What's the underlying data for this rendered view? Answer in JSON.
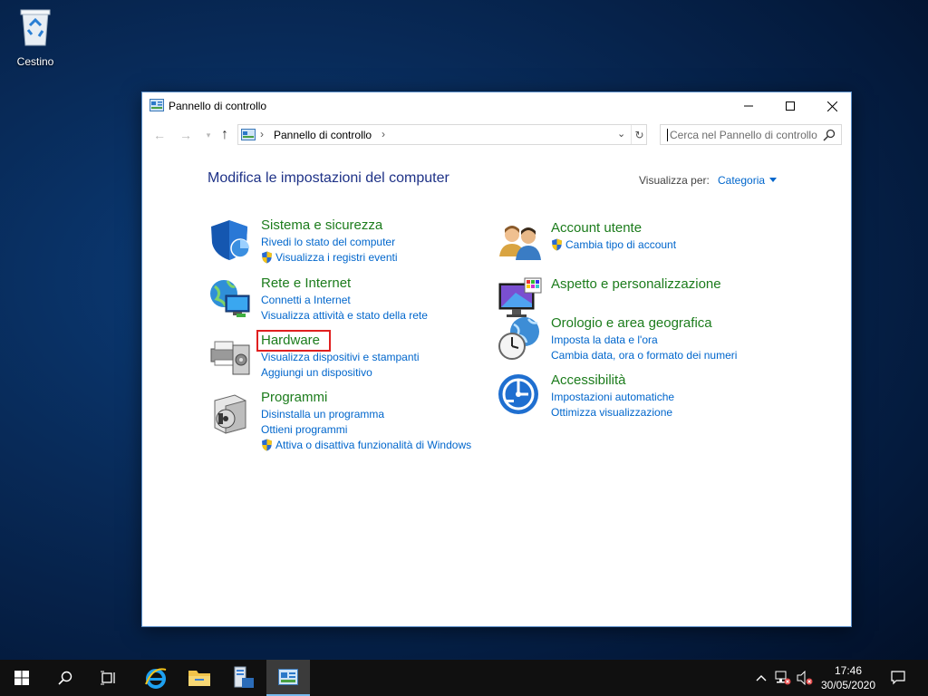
{
  "desktop": {
    "recycle_bin_label": "Cestino"
  },
  "window": {
    "title": "Pannello di controllo",
    "breadcrumb": "Pannello di controllo",
    "search_placeholder": "Cerca nel Pannello di controllo"
  },
  "main": {
    "heading": "Modifica le impostazioni del computer",
    "view_by_label": "Visualizza per:",
    "view_by_value": "Categoria"
  },
  "categories_left": [
    {
      "title": "Sistema e sicurezza",
      "links": [
        "Rivedi lo stato del computer",
        "Visualizza i registri eventi"
      ]
    },
    {
      "title": "Rete e Internet",
      "links": [
        "Connetti a Internet",
        "Visualizza attività e stato della rete"
      ]
    },
    {
      "title": "Hardware",
      "links": [
        "Visualizza dispositivi e stampanti",
        "Aggiungi un dispositivo"
      ]
    },
    {
      "title": "Programmi",
      "links": [
        "Disinstalla un programma",
        "Ottieni programmi",
        "Attiva o disattiva funzionalità di Windows"
      ]
    }
  ],
  "categories_right": [
    {
      "title": "Account utente",
      "links": [
        "Cambia tipo di account"
      ]
    },
    {
      "title": "Aspetto e personalizzazione",
      "links": []
    },
    {
      "title": "Orologio e area geografica",
      "links": [
        "Imposta la data e l'ora",
        "Cambia data, ora o formato dei numeri"
      ]
    },
    {
      "title": "Accessibilità",
      "links": [
        "Impostazioni automatiche",
        "Ottimizza visualizzazione"
      ]
    }
  ],
  "taskbar": {
    "time": "17:46",
    "date": "30/05/2020"
  },
  "colors": {
    "title_green": "#1c7c1c",
    "link_blue": "#0066cc",
    "heading_blue": "#1e3287",
    "highlight_red": "#e02020"
  }
}
